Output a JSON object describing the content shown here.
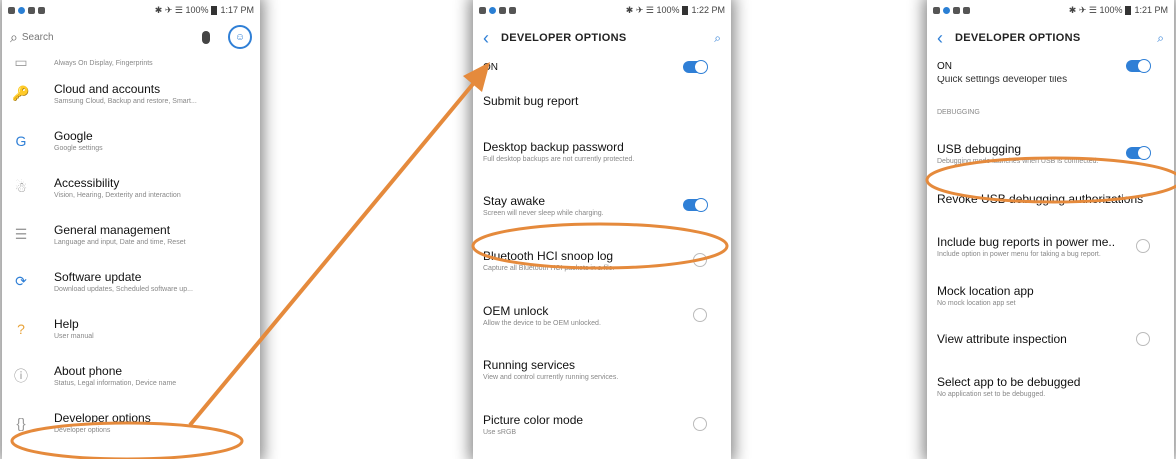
{
  "colors": {
    "accent": "#2f7fd6",
    "highlight": "#e58a3c"
  },
  "phone1": {
    "status": {
      "icons": "✱ ✈ ☰ 100%",
      "time": "1:17 PM"
    },
    "search": {
      "placeholder": "Search",
      "search_icon": "search-icon",
      "mic_icon": "mic-icon",
      "account_icon": "account-icon"
    },
    "items": [
      {
        "title": "",
        "subtitle": "Always On Display, Fingerprints",
        "icon": "lock-icon",
        "glyph": "▭"
      },
      {
        "title": "Cloud and accounts",
        "subtitle": "Samsung Cloud, Backup and restore, Smart...",
        "icon": "key-icon",
        "glyph": "🔑"
      },
      {
        "title": "Google",
        "subtitle": "Google settings",
        "icon": "google-icon",
        "glyph": "G"
      },
      {
        "title": "Accessibility",
        "subtitle": "Vision, Hearing, Dexterity and interaction",
        "icon": "accessibility-icon",
        "glyph": "☃"
      },
      {
        "title": "General management",
        "subtitle": "Language and input, Date and time, Reset",
        "icon": "sliders-icon",
        "glyph": "☰"
      },
      {
        "title": "Software update",
        "subtitle": "Download updates, Scheduled software up...",
        "icon": "update-icon",
        "glyph": "⟳"
      },
      {
        "title": "Help",
        "subtitle": "User manual",
        "icon": "help-icon",
        "glyph": "?"
      },
      {
        "title": "About phone",
        "subtitle": "Status, Legal information, Device name",
        "icon": "info-icon",
        "glyph": "ⓘ"
      },
      {
        "title": "Developer options",
        "subtitle": "Developer options",
        "icon": "code-braces-icon",
        "glyph": "{}"
      }
    ]
  },
  "phone2": {
    "status": {
      "icons": "✱ ✈ ☰ 100%",
      "time": "1:22 PM"
    },
    "title": "DEVELOPER OPTIONS",
    "on_label": "ON",
    "rows": [
      {
        "title": "Submit bug report",
        "subtitle": "",
        "control": "none"
      },
      {
        "title": "Desktop backup password",
        "subtitle": "Full desktop backups are not currently protected.",
        "control": "none"
      },
      {
        "title": "Stay awake",
        "subtitle": "Screen will never sleep while charging.",
        "control": "toggle"
      },
      {
        "title": "Bluetooth HCI snoop log",
        "subtitle": "Capture all Bluetooth HCI packets in a file.",
        "control": "radio"
      },
      {
        "title": "OEM unlock",
        "subtitle": "Allow the device to be OEM unlocked.",
        "control": "radio"
      },
      {
        "title": "Running services",
        "subtitle": "View and control currently running services.",
        "control": "none"
      },
      {
        "title": "Picture color mode",
        "subtitle": "Use sRGB",
        "control": "radio"
      }
    ]
  },
  "phone3": {
    "status": {
      "icons": "✱ ✈ ☰ 100%",
      "time": "1:21 PM"
    },
    "title": "DEVELOPER OPTIONS",
    "on_label": "ON",
    "cut_text": "Quick settings developer tiles",
    "section": "DEBUGGING",
    "rows": [
      {
        "title": "USB debugging",
        "subtitle": "Debugging mode launches when USB is connected.",
        "control": "toggle"
      },
      {
        "title": "Revoke USB debugging authorizations",
        "subtitle": "",
        "control": "none"
      },
      {
        "title": "Include bug reports in power me..",
        "subtitle": "Include option in power menu for taking a bug report.",
        "control": "radio"
      },
      {
        "title": "Mock location app",
        "subtitle": "No mock location app set",
        "control": "none"
      },
      {
        "title": "View attribute inspection",
        "subtitle": "",
        "control": "radio"
      },
      {
        "title": "Select app to be debugged",
        "subtitle": "No application set to be debugged.",
        "control": "none"
      }
    ]
  }
}
